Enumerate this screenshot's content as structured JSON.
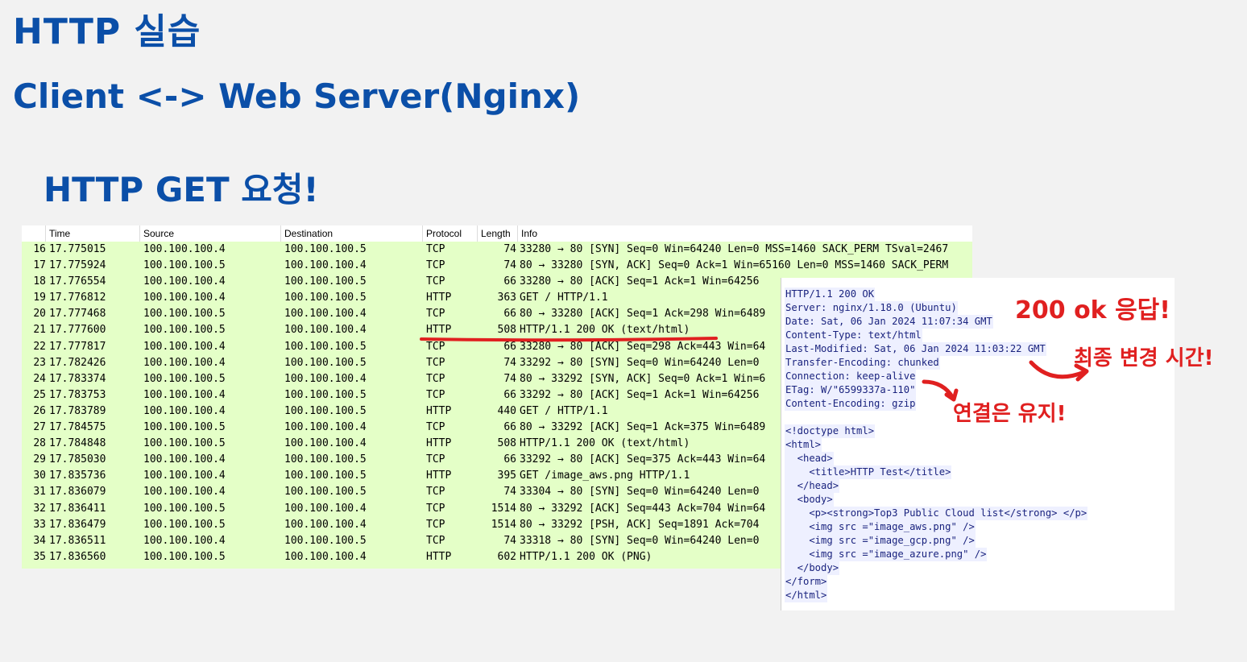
{
  "slide": {
    "title": "HTTP 실습",
    "subtitle": "Client <-> Web Server(Nginx)",
    "section": "HTTP GET 요청!"
  },
  "packet_list": {
    "columns": [
      "Time",
      "Source",
      "Destination",
      "Protocol",
      "Length",
      "Info"
    ],
    "rows": [
      {
        "no": "16",
        "time": "17.775015",
        "src": "100.100.100.4",
        "dst": "100.100.100.5",
        "proto": "TCP",
        "len": "74",
        "info": "33280 → 80 [SYN] Seq=0 Win=64240 Len=0 MSS=1460 SACK_PERM TSval=2467"
      },
      {
        "no": "17",
        "time": "17.775924",
        "src": "100.100.100.5",
        "dst": "100.100.100.4",
        "proto": "TCP",
        "len": "74",
        "info": "80 → 33280 [SYN, ACK] Seq=0 Ack=1 Win=65160 Len=0 MSS=1460 SACK_PERM"
      },
      {
        "no": "18",
        "time": "17.776554",
        "src": "100.100.100.4",
        "dst": "100.100.100.5",
        "proto": "TCP",
        "len": "66",
        "info": "33280 → 80 [ACK] Seq=1 Ack=1 Win=64256"
      },
      {
        "no": "19",
        "time": "17.776812",
        "src": "100.100.100.4",
        "dst": "100.100.100.5",
        "proto": "HTTP",
        "len": "363",
        "info": "GET / HTTP/1.1"
      },
      {
        "no": "20",
        "time": "17.777468",
        "src": "100.100.100.5",
        "dst": "100.100.100.4",
        "proto": "TCP",
        "len": "66",
        "info": "80 → 33280 [ACK] Seq=1 Ack=298 Win=6489"
      },
      {
        "no": "21",
        "time": "17.777600",
        "src": "100.100.100.5",
        "dst": "100.100.100.4",
        "proto": "HTTP",
        "len": "508",
        "info": "HTTP/1.1 200 OK  (text/html)"
      },
      {
        "no": "22",
        "time": "17.777817",
        "src": "100.100.100.4",
        "dst": "100.100.100.5",
        "proto": "TCP",
        "len": "66",
        "info": "33280 → 80 [ACK] Seq=298 Ack=443 Win=64"
      },
      {
        "no": "23",
        "time": "17.782426",
        "src": "100.100.100.4",
        "dst": "100.100.100.5",
        "proto": "TCP",
        "len": "74",
        "info": "33292 → 80 [SYN] Seq=0 Win=64240 Len=0"
      },
      {
        "no": "24",
        "time": "17.783374",
        "src": "100.100.100.5",
        "dst": "100.100.100.4",
        "proto": "TCP",
        "len": "74",
        "info": "80 → 33292 [SYN, ACK] Seq=0 Ack=1 Win=6"
      },
      {
        "no": "25",
        "time": "17.783753",
        "src": "100.100.100.4",
        "dst": "100.100.100.5",
        "proto": "TCP",
        "len": "66",
        "info": "33292 → 80 [ACK] Seq=1 Ack=1 Win=64256"
      },
      {
        "no": "26",
        "time": "17.783789",
        "src": "100.100.100.4",
        "dst": "100.100.100.5",
        "proto": "HTTP",
        "len": "440",
        "info": "GET / HTTP/1.1"
      },
      {
        "no": "27",
        "time": "17.784575",
        "src": "100.100.100.5",
        "dst": "100.100.100.4",
        "proto": "TCP",
        "len": "66",
        "info": "80 → 33292 [ACK] Seq=1 Ack=375 Win=6489"
      },
      {
        "no": "28",
        "time": "17.784848",
        "src": "100.100.100.5",
        "dst": "100.100.100.4",
        "proto": "HTTP",
        "len": "508",
        "info": "HTTP/1.1 200 OK  (text/html)"
      },
      {
        "no": "29",
        "time": "17.785030",
        "src": "100.100.100.4",
        "dst": "100.100.100.5",
        "proto": "TCP",
        "len": "66",
        "info": "33292 → 80 [ACK] Seq=375 Ack=443 Win=64"
      },
      {
        "no": "30",
        "time": "17.835736",
        "src": "100.100.100.4",
        "dst": "100.100.100.5",
        "proto": "HTTP",
        "len": "395",
        "info": "GET /image_aws.png HTTP/1.1"
      },
      {
        "no": "31",
        "time": "17.836079",
        "src": "100.100.100.4",
        "dst": "100.100.100.5",
        "proto": "TCP",
        "len": "74",
        "info": "33304 → 80 [SYN] Seq=0 Win=64240 Len=0"
      },
      {
        "no": "32",
        "time": "17.836411",
        "src": "100.100.100.5",
        "dst": "100.100.100.4",
        "proto": "TCP",
        "len": "1514",
        "info": "80 → 33292 [ACK] Seq=443 Ack=704 Win=64"
      },
      {
        "no": "33",
        "time": "17.836479",
        "src": "100.100.100.5",
        "dst": "100.100.100.4",
        "proto": "TCP",
        "len": "1514",
        "info": "80 → 33292 [PSH, ACK] Seq=1891 Ack=704"
      },
      {
        "no": "34",
        "time": "17.836511",
        "src": "100.100.100.4",
        "dst": "100.100.100.5",
        "proto": "TCP",
        "len": "74",
        "info": "33318 → 80 [SYN] Seq=0 Win=64240 Len=0"
      },
      {
        "no": "35",
        "time": "17.836560",
        "src": "100.100.100.5",
        "dst": "100.100.100.4",
        "proto": "HTTP",
        "len": "602",
        "info": "HTTP/1.1 200 OK  (PNG)"
      }
    ]
  },
  "response": {
    "headers": [
      "HTTP/1.1 200 OK",
      "Server: nginx/1.18.0 (Ubuntu)",
      "Date: Sat, 06 Jan 2024 11:07:34 GMT",
      "Content-Type: text/html",
      "Last-Modified: Sat, 06 Jan 2024 11:03:22 GMT",
      "Transfer-Encoding: chunked",
      "Connection: keep-alive",
      "ETag: W/\"6599337a-110\"",
      "Content-Encoding: gzip"
    ],
    "body": [
      "<!doctype html>",
      "<html>",
      "  <head>",
      "    <title>HTTP Test</title>",
      "  </head>",
      "  <body>",
      "    <p><strong>Top3 Public Cloud list</strong> </p>",
      "    <img src =\"image_aws.png\" />",
      "    <img src =\"image_gcp.png\" />",
      "    <img src =\"image_azure.png\" />",
      "  </body>",
      "</form>",
      "</html>"
    ]
  },
  "annotations": {
    "ok_response": "200 ok 응답!",
    "last_modified": "최종 변경 시간!",
    "keep_alive": "연결은 유지!",
    "color": "#e02020"
  },
  "colors": {
    "title": "#0b4fa8",
    "packet_row_bg": "#e4ffc7",
    "response_text": "#1a237e",
    "response_highlight": "#eef0ff"
  }
}
